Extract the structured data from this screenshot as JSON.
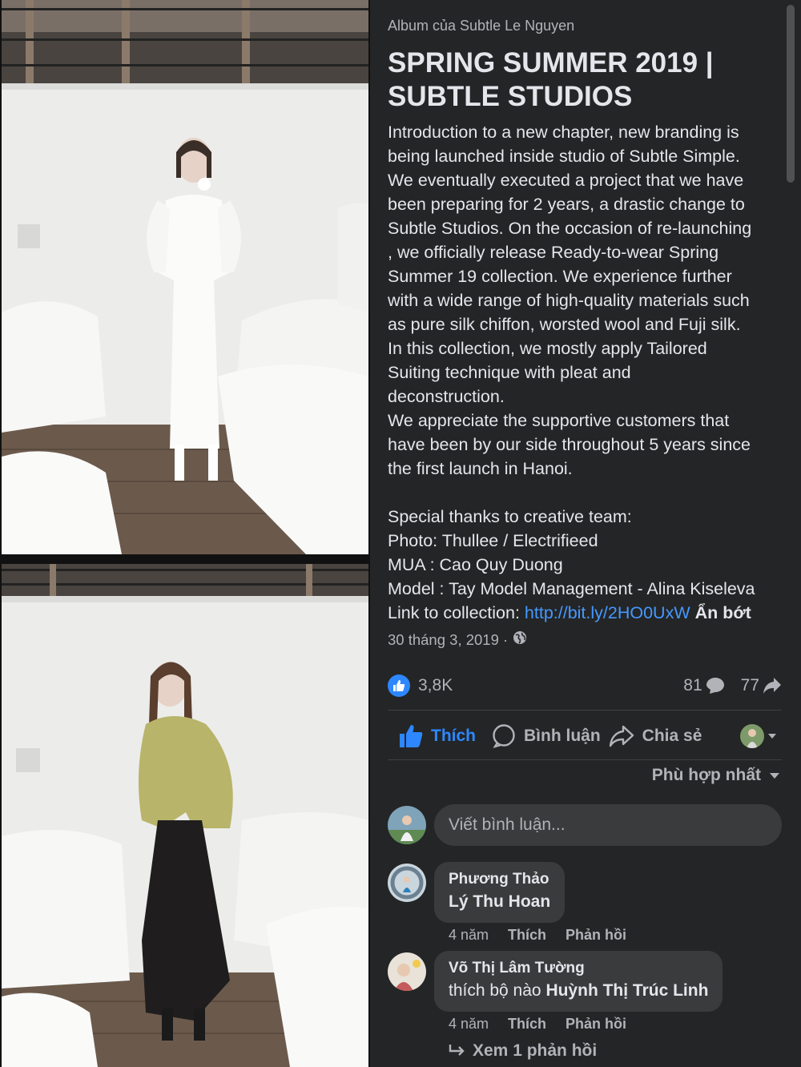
{
  "album": {
    "owner": "Album của Subtle Le Nguyen",
    "title": "SPRING SUMMER 2019 | SUBTLE STUDIOS",
    "description_lines": [
      "Introduction to a new chapter, new branding is",
      "being launched inside studio of Subtle Simple.",
      "We eventually executed a project that we have",
      "been preparing for 2 years, a drastic change to",
      "Subtle Studios. On the occasion of re-launching",
      ", we officially release Ready-to-wear Spring",
      "Summer 19 collection. We experience further",
      "with a wide range of high-quality materials such",
      "as pure silk chiffon, worsted wool and Fuji silk.",
      "In this collection, we mostly apply Tailored",
      "Suiting technique with pleat and",
      "deconstruction.",
      "We appreciate the supportive customers that",
      "have been by our side throughout 5 years since",
      "the first launch in Hanoi."
    ],
    "credits_lines": [
      "Special thanks to creative team:",
      "Photo: Thullee / Electrifieed",
      "MUA : Cao Quy Duong",
      "Model : Tay Model Management - Alina Kiseleva"
    ],
    "link_prefix": "Link to collection:",
    "link_url": "http://bit.ly/2HO0UxW",
    "see_less": "Ẩn bớt",
    "date": "30 tháng 3, 2019 ·",
    "privacy_icon": "globe-icon"
  },
  "stats": {
    "reactions": "3,8K",
    "comments": "81",
    "shares": "77"
  },
  "actions": {
    "like": "Thích",
    "comment": "Bình luận",
    "share": "Chia sẻ"
  },
  "sort": {
    "label": "Phù hợp nhất"
  },
  "composer": {
    "placeholder": "Viết bình luận..."
  },
  "comments": [
    {
      "author": "Phương Thảo",
      "text": "Lý Thu Hoan",
      "mention": "",
      "age": "4 năm",
      "like": "Thích",
      "reply": "Phản hồi"
    },
    {
      "author": "Võ Thị Lâm Tường",
      "text": "thích bộ nào ",
      "mention": "Huỳnh Thị Trúc Linh",
      "age": "4 năm",
      "like": "Thích",
      "reply": "Phản hồi"
    }
  ],
  "view_replies": "Xem 1 phản hồi",
  "colors": {
    "panel_bg": "#242526",
    "accent_blue": "#2d88ff",
    "link_blue": "#4599ff",
    "secondary_text": "#b0b3b8",
    "primary_text": "#e4e6eb",
    "bubble_bg": "#3a3b3c"
  }
}
